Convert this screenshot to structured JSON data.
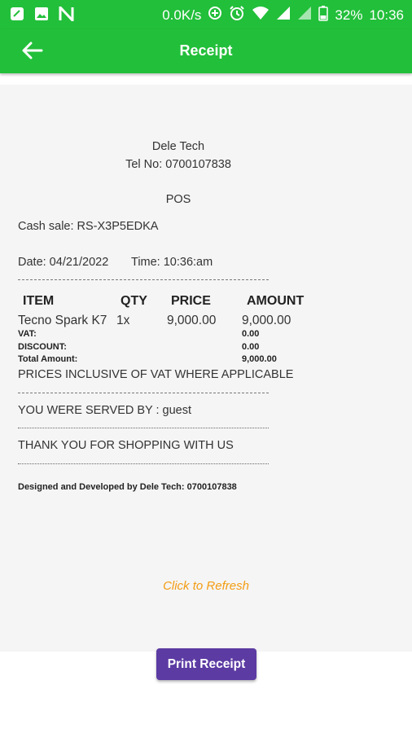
{
  "status_bar": {
    "net_speed": "0.0K/s",
    "battery": "32%",
    "time": "10:36",
    "left_icons": [
      "notification-icon",
      "gallery-icon",
      "n-app-icon"
    ],
    "right_icons": [
      "data-saver-icon",
      "alarm-icon",
      "wifi-icon",
      "signal-icon",
      "signal-icon-2",
      "battery-icon"
    ]
  },
  "app_bar": {
    "title": "Receipt",
    "back_icon": "arrow-left-icon"
  },
  "receipt": {
    "shop_name": "Dele Tech",
    "tel": "Tel No: 0700107838",
    "terminal": "POS",
    "cash_sale": "Cash sale: RS-X3P5EDKA",
    "date": "Date: 04/21/2022",
    "time": "Time: 10:36:am",
    "columns": {
      "item": "ITEM",
      "qty": "QTY",
      "price": "PRICE",
      "amount": "AMOUNT"
    },
    "items": [
      {
        "name": "Tecno Spark K7",
        "qty": "1x",
        "price": "9,000.00",
        "amount": "9,000.00"
      }
    ],
    "summary": {
      "vat_label": "VAT:",
      "vat_value": "0.00",
      "discount_label": "DISCOUNT:",
      "discount_value": "0.00",
      "total_label": "Total Amount:",
      "total_value": "9,000.00"
    },
    "vat_note": "PRICES INCLUSIVE OF VAT WHERE APPLICABLE",
    "served_by": "YOU WERE SERVED BY : guest",
    "thanks": "THANK YOU FOR SHOPPING WITH US",
    "credit": "Designed and Developed by Dele Tech: 0700107838"
  },
  "refresh_label": "Click to Refresh",
  "print_button": "Print Receipt",
  "colors": {
    "primary": "#22bf3a",
    "button": "#5c3ba3",
    "refresh": "#f39c12"
  }
}
